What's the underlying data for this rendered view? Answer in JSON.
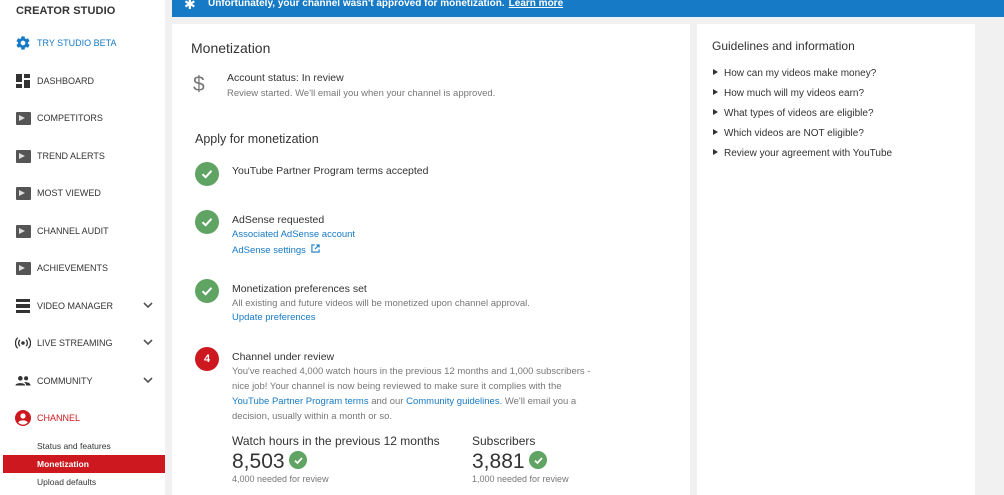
{
  "sidebar": {
    "title": "CREATOR STUDIO",
    "items": [
      {
        "label": "TRY STUDIO BETA",
        "icon": "gear-icon"
      },
      {
        "label": "DASHBOARD",
        "icon": "dashboard-icon"
      },
      {
        "label": "COMPETITORS",
        "icon": "video-thumbnail-icon"
      },
      {
        "label": "TREND ALERTS",
        "icon": "video-thumbnail-icon"
      },
      {
        "label": "MOST VIEWED",
        "icon": "video-thumbnail-icon"
      },
      {
        "label": "CHANNEL AUDIT",
        "icon": "video-thumbnail-icon"
      },
      {
        "label": "ACHIEVEMENTS",
        "icon": "video-thumbnail-icon"
      },
      {
        "label": "VIDEO MANAGER",
        "icon": "video-manager-icon"
      },
      {
        "label": "LIVE STREAMING",
        "icon": "live-streaming-icon"
      },
      {
        "label": "COMMUNITY",
        "icon": "people-icon"
      },
      {
        "label": "CHANNEL",
        "icon": "account-icon"
      }
    ],
    "sub_items": [
      {
        "label": "Status and features"
      },
      {
        "label": "Monetization"
      },
      {
        "label": "Upload defaults"
      }
    ]
  },
  "banner": {
    "message": "Unfortunately, your channel wasn't approved for monetization.",
    "link": "Learn more"
  },
  "main": {
    "title": "Monetization",
    "account_status": "Account status: In review",
    "account_sub": "Review started. We'll email you when your channel is approved.",
    "apply_heading": "Apply for monetization",
    "steps": [
      {
        "title": "YouTube Partner Program terms accepted"
      },
      {
        "title": "AdSense requested",
        "link1": "Associated AdSense account",
        "link2": "AdSense settings"
      },
      {
        "title": "Monetization preferences set",
        "desc": "All existing and future videos will be monetized upon channel approval.",
        "link1": "Update preferences"
      },
      {
        "number": "4",
        "title": "Channel under review",
        "desc_a": "You've reached 4,000 watch hours in the previous 12 months and 1,000 subscribers - nice job! Your channel is now being reviewed to make sure it complies with the",
        "link_a": "YouTube Partner Program terms",
        "desc_b": "and our",
        "link_b": "Community guidelines",
        "desc_c": ". We'll email you a decision, usually within a month or so."
      }
    ],
    "stats": [
      {
        "label": "Watch hours in the previous 12 months",
        "value": "8,503",
        "note": "4,000 needed for review"
      },
      {
        "label": "Subscribers",
        "value": "3,881",
        "note": "1,000 needed for review"
      }
    ]
  },
  "guidelines": {
    "title": "Guidelines and information",
    "items": [
      "How can my videos make money?",
      "How much will my videos earn?",
      "What types of videos are eligible?",
      "Which videos are NOT eligible?",
      "Review your agreement with YouTube"
    ]
  },
  "colors": {
    "brand_red": "#cc181e",
    "link_blue": "#167ac6",
    "ok_green": "#5fa463"
  }
}
